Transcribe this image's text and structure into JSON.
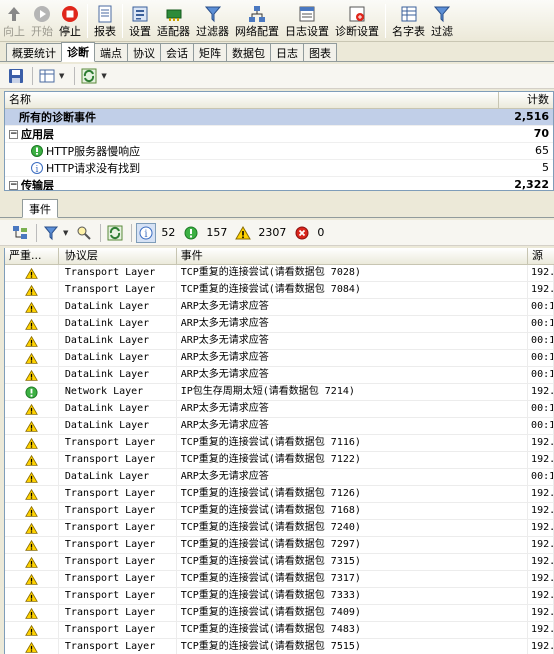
{
  "toolbar": {
    "buttons": [
      {
        "label": "向上",
        "disabled": true
      },
      {
        "label": "开始",
        "disabled": true
      },
      {
        "label": "停止",
        "disabled": false
      },
      {
        "label": "报表",
        "disabled": false
      },
      {
        "label": "设置",
        "disabled": false
      },
      {
        "label": "适配器",
        "disabled": false
      },
      {
        "label": "过滤器",
        "disabled": false
      },
      {
        "label": "网络配置",
        "disabled": false
      },
      {
        "label": "日志设置",
        "disabled": false
      },
      {
        "label": "诊断设置",
        "disabled": false
      },
      {
        "label": "名字表",
        "disabled": false
      },
      {
        "label": "过滤",
        "disabled": false
      }
    ]
  },
  "tabs": [
    "概要统计",
    "诊断",
    "端点",
    "协议",
    "会话",
    "矩阵",
    "数据包",
    "日志",
    "图表"
  ],
  "active_tab": "诊断",
  "diag": {
    "col_name": "名称",
    "col_count": "计数",
    "rows": [
      {
        "label": "所有的诊断事件",
        "count": "2,516",
        "kind": "selected"
      },
      {
        "label": "应用层",
        "count": "70",
        "kind": "group"
      },
      {
        "label": "HTTP服务器慢响应",
        "count": "65",
        "kind": "item-green"
      },
      {
        "label": "HTTP请求没有找到",
        "count": "5",
        "kind": "item-info"
      },
      {
        "label": "传输层",
        "count": "2,322",
        "kind": "group"
      }
    ]
  },
  "events": {
    "tab_label": "事件",
    "counts": {
      "info": "52",
      "ok": "157",
      "warn": "2307",
      "error": "0"
    },
    "columns": [
      "严重...",
      "协议层",
      "事件",
      "源"
    ],
    "rows": [
      {
        "sev": "warn",
        "layer": "Transport Layer",
        "event": "TCP重复的连接尝试(请看数据包 7028)",
        "src": "192."
      },
      {
        "sev": "warn",
        "layer": "Transport Layer",
        "event": "TCP重复的连接尝试(请看数据包 7084)",
        "src": "192."
      },
      {
        "sev": "warn",
        "layer": "DataLink Layer",
        "event": "ARP太多无请求应答",
        "src": "00:1"
      },
      {
        "sev": "warn",
        "layer": "DataLink Layer",
        "event": "ARP太多无请求应答",
        "src": "00:1"
      },
      {
        "sev": "warn",
        "layer": "DataLink Layer",
        "event": "ARP太多无请求应答",
        "src": "00:1"
      },
      {
        "sev": "warn",
        "layer": "DataLink Layer",
        "event": "ARP太多无请求应答",
        "src": "00:1"
      },
      {
        "sev": "warn",
        "layer": "DataLink Layer",
        "event": "ARP太多无请求应答",
        "src": "00:1"
      },
      {
        "sev": "ok",
        "layer": "Network Layer",
        "event": "IP包生存周期太短(请看数据包 7214)",
        "src": "192."
      },
      {
        "sev": "warn",
        "layer": "DataLink Layer",
        "event": "ARP太多无请求应答",
        "src": "00:1"
      },
      {
        "sev": "warn",
        "layer": "DataLink Layer",
        "event": "ARP太多无请求应答",
        "src": "00:1"
      },
      {
        "sev": "warn",
        "layer": "Transport Layer",
        "event": "TCP重复的连接尝试(请看数据包 7116)",
        "src": "192."
      },
      {
        "sev": "warn",
        "layer": "Transport Layer",
        "event": "TCP重复的连接尝试(请看数据包 7122)",
        "src": "192."
      },
      {
        "sev": "warn",
        "layer": "DataLink Layer",
        "event": "ARP太多无请求应答",
        "src": "00:1"
      },
      {
        "sev": "warn",
        "layer": "Transport Layer",
        "event": "TCP重复的连接尝试(请看数据包 7126)",
        "src": "192."
      },
      {
        "sev": "warn",
        "layer": "Transport Layer",
        "event": "TCP重复的连接尝试(请看数据包 7168)",
        "src": "192."
      },
      {
        "sev": "warn",
        "layer": "Transport Layer",
        "event": "TCP重复的连接尝试(请看数据包 7240)",
        "src": "192."
      },
      {
        "sev": "warn",
        "layer": "Transport Layer",
        "event": "TCP重复的连接尝试(请看数据包 7297)",
        "src": "192."
      },
      {
        "sev": "warn",
        "layer": "Transport Layer",
        "event": "TCP重复的连接尝试(请看数据包 7315)",
        "src": "192."
      },
      {
        "sev": "warn",
        "layer": "Transport Layer",
        "event": "TCP重复的连接尝试(请看数据包 7317)",
        "src": "192."
      },
      {
        "sev": "warn",
        "layer": "Transport Layer",
        "event": "TCP重复的连接尝试(请看数据包 7333)",
        "src": "192."
      },
      {
        "sev": "warn",
        "layer": "Transport Layer",
        "event": "TCP重复的连接尝试(请看数据包 7409)",
        "src": "192."
      },
      {
        "sev": "warn",
        "layer": "Transport Layer",
        "event": "TCP重复的连接尝试(请看数据包 7483)",
        "src": "192."
      },
      {
        "sev": "warn",
        "layer": "Transport Layer",
        "event": "TCP重复的连接尝试(请看数据包 7515)",
        "src": "192."
      }
    ]
  }
}
